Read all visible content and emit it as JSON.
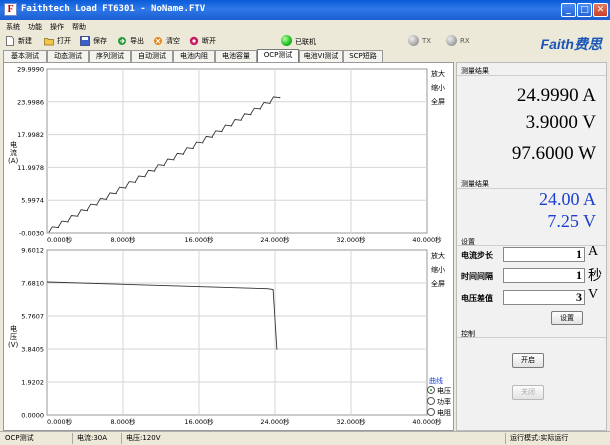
{
  "window": {
    "title": "Faithtech Load FT6301 - NoName.FTV",
    "min": "_",
    "max": "□",
    "close": "✕"
  },
  "menu": [
    "系统",
    "功能",
    "操作",
    "帮助"
  ],
  "toolbar": {
    "new": "新建",
    "open": "打开",
    "save": "保存",
    "export": "导出",
    "clear": "清空",
    "disconnect": "断开",
    "connected": "已联机",
    "tx": "TX",
    "rx": "RX"
  },
  "brand": {
    "name": "Faith",
    "cn": "费思"
  },
  "tabs": [
    "基本测试",
    "动态测试",
    "序列测试",
    "自动测试",
    "电池内阻",
    "电池容量",
    "OCP测试",
    "电池VI测试",
    "SCP短路"
  ],
  "active_tab": 6,
  "chart_controls": {
    "zoom_in": "放大",
    "zoom_out": "缩小",
    "full": "全屏"
  },
  "curve_group": {
    "title": "曲线",
    "options": [
      "电压",
      "功率",
      "电阻"
    ],
    "selected": 0
  },
  "chart_data": [
    {
      "type": "line",
      "ylabel": "电流(A)",
      "xlim": [
        0,
        40
      ],
      "ylim": [
        -0.003,
        29.999
      ],
      "yticks": [
        "29.9990",
        "23.9986",
        "17.9982",
        "11.9978",
        "5.9974",
        "-0.0030"
      ],
      "xticks": [
        "0.000秒",
        "8.000秒",
        "16.000秒",
        "24.000秒",
        "32.000秒",
        "40.000秒"
      ],
      "series": [
        {
          "stair_start_s": 0.2,
          "stair_end_s": 24.5,
          "start_a": 0.1,
          "end_a": 24.9,
          "steps": 24
        }
      ]
    },
    {
      "type": "line",
      "ylabel": "电压(V)",
      "xlim": [
        0,
        40
      ],
      "ylim": [
        0.0,
        9.6012
      ],
      "yticks": [
        "9.6012",
        "7.6810",
        "5.7607",
        "3.8405",
        "1.9202",
        "0.0000"
      ],
      "xticks": [
        "0.000秒",
        "8.000秒",
        "16.000秒",
        "24.000秒",
        "32.000秒",
        "40.000秒"
      ],
      "series": [
        {
          "x": [
            0,
            23.2,
            23.8,
            24.2
          ],
          "y": [
            7.74,
            7.35,
            7.3,
            3.8
          ]
        }
      ]
    }
  ],
  "measure1": {
    "title": "测量结果",
    "current": "24.9990 A",
    "voltage": "3.9000 V",
    "power": "97.6000 W"
  },
  "measure2": {
    "title": "测量结果",
    "current": "24.00 A",
    "voltage": "7.25 V"
  },
  "settings": {
    "title": "设置",
    "step_label": "电流步长",
    "step_value": "1",
    "step_unit": "A",
    "interval_label": "时间间隔",
    "interval_value": "1",
    "interval_unit": "秒",
    "vdiff_label": "电压差值",
    "vdiff_value": "3",
    "vdiff_unit": "V",
    "apply": "设置"
  },
  "control": {
    "title": "控制",
    "start": "开启",
    "stop": "关闭"
  },
  "status": {
    "test": "OCP测试",
    "current": "电流:30A",
    "voltage": "电压:120V",
    "mode": "运行模式:实际运行"
  },
  "colors": {
    "accent": "#1b56b8",
    "blue_readout": "#1a3fd1",
    "led_on": "#22c22a"
  }
}
